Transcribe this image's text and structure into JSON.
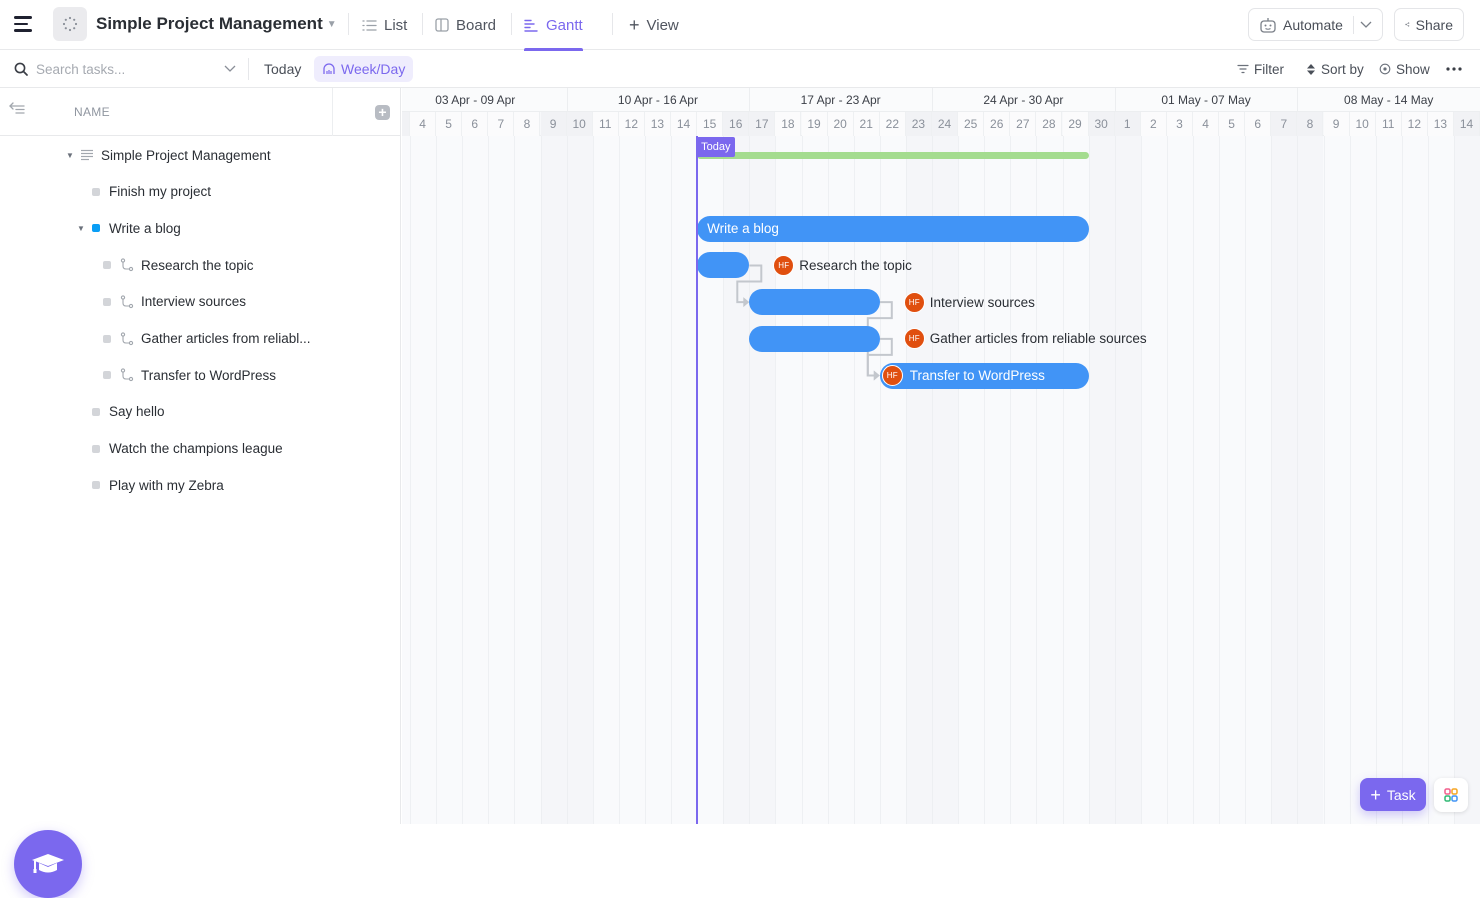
{
  "topbar": {
    "space_title": "Simple Project Management",
    "views": [
      {
        "label": "List",
        "icon": "list-icon",
        "active": false
      },
      {
        "label": "Board",
        "icon": "board-icon",
        "active": false
      },
      {
        "label": "Gantt",
        "icon": "gantt-icon",
        "active": true
      }
    ],
    "add_view_label": "View",
    "automate_label": "Automate",
    "share_label": "Share"
  },
  "toolbar": {
    "search_placeholder": "Search tasks...",
    "today_label": "Today",
    "scale_label": "Week/Day",
    "filter_label": "Filter",
    "sort_label": "Sort by",
    "show_label": "Show"
  },
  "left_panel": {
    "name_header": "NAME",
    "rows": [
      {
        "label": "Simple Project Management",
        "level": 0,
        "type": "list",
        "expanded": true
      },
      {
        "label": "Finish my project",
        "level": 1,
        "type": "task",
        "status_color": "#d3d5d9"
      },
      {
        "label": "Write a blog",
        "level": 1,
        "type": "task",
        "expanded": true,
        "status_color": "#0a9ef5"
      },
      {
        "label": "Research the topic",
        "level": 2,
        "type": "subtask",
        "status_color": "#d3d5d9"
      },
      {
        "label": "Interview sources",
        "level": 2,
        "type": "subtask",
        "status_color": "#d3d5d9"
      },
      {
        "label": "Gather articles from reliabl...",
        "level": 2,
        "type": "subtask",
        "status_color": "#d3d5d9"
      },
      {
        "label": "Transfer to WordPress",
        "level": 2,
        "type": "subtask",
        "status_color": "#d3d5d9"
      },
      {
        "label": "Say hello",
        "level": 1,
        "type": "task",
        "status_color": "#d3d5d9"
      },
      {
        "label": "Watch the champions league",
        "level": 1,
        "type": "task",
        "status_color": "#d3d5d9"
      },
      {
        "label": "Play with my Zebra",
        "level": 1,
        "type": "task",
        "status_color": "#d3d5d9"
      }
    ]
  },
  "gantt": {
    "weeks": [
      "03 Apr - 09 Apr",
      "10 Apr - 16 Apr",
      "17 Apr - 23 Apr",
      "24 Apr - 30 Apr",
      "01 May - 07 May",
      "08 May - 14 May"
    ],
    "days": [
      "4",
      "5",
      "6",
      "7",
      "8",
      "9",
      "10",
      "11",
      "12",
      "13",
      "14",
      "15",
      "16",
      "17",
      "18",
      "19",
      "20",
      "21",
      "22",
      "23",
      "24",
      "25",
      "26",
      "27",
      "28",
      "29",
      "30",
      "1",
      "2",
      "3",
      "4",
      "5",
      "6",
      "7",
      "8",
      "9",
      "10",
      "11",
      "12",
      "13",
      "14"
    ],
    "today_label": "Today",
    "today_day_index": 11,
    "project_span": {
      "start_day_index": 11,
      "end_day_index": 25,
      "color": "#a4dc8f"
    },
    "bars": [
      {
        "row": 2,
        "label": "Write a blog",
        "start_day_index": 11,
        "end_day_index": 25,
        "label_inside": true,
        "assignee": null
      },
      {
        "row": 3,
        "label": "Research the topic",
        "start_day_index": 11,
        "end_day_index": 12,
        "label_inside": false,
        "assignee": "HF"
      },
      {
        "row": 4,
        "label": "Interview sources",
        "start_day_index": 13,
        "end_day_index": 17,
        "label_inside": false,
        "assignee": "HF"
      },
      {
        "row": 5,
        "label": "Gather articles from reliable sources",
        "start_day_index": 13,
        "end_day_index": 17,
        "label_inside": false,
        "assignee": "HF"
      },
      {
        "row": 6,
        "label": "Transfer to WordPress",
        "start_day_index": 18,
        "end_day_index": 25,
        "label_inside": true,
        "assignee": "HF"
      }
    ],
    "dependencies": [
      [
        3,
        4
      ],
      [
        4,
        6
      ],
      [
        5,
        6
      ]
    ],
    "bar_color": "#4194f6",
    "avatar_color": "#e04f0f"
  },
  "footer": {
    "task_button_label": "Task"
  },
  "colors": {
    "accent": "#7b68ee"
  }
}
